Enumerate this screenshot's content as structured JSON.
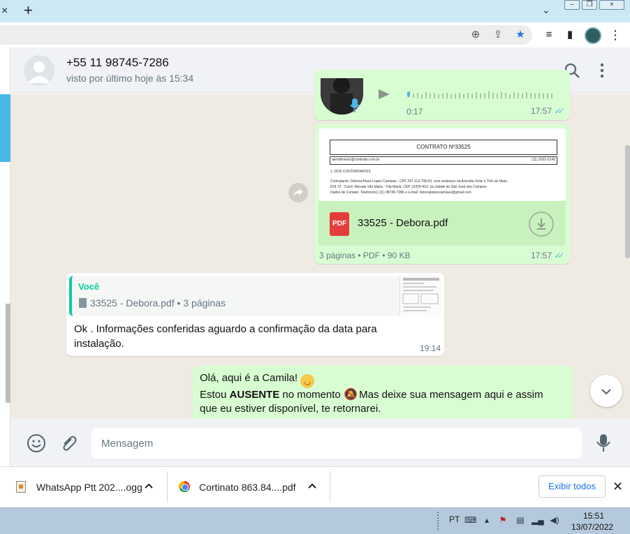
{
  "browser": {
    "tab_close": "×",
    "new_tab": "+",
    "tab_search": "⌄",
    "window_min": "–",
    "window_restore": "❐",
    "window_close": "×"
  },
  "toolbar": {
    "zoom_icon": "⊕",
    "share_icon": "⇪",
    "star_icon": "★",
    "media_icon": "≡",
    "sidepanel_icon": "▮",
    "menu_icon": "⋮"
  },
  "chat_header": {
    "contact_name": "+55 11 98745-7286",
    "status": "visto por último hoje às 15:34"
  },
  "messages": {
    "audio": {
      "duration": "0:17",
      "time": "17:57",
      "ticks": "✓✓"
    },
    "pdf": {
      "preview_title": "CONTRATO Nº33525",
      "preview_email": "atendimento@cortinato.com.br",
      "preview_phone": "(11) 2022-2148",
      "preview_section": "1. DOS CONTRATANTES",
      "preview_line1": "Contratante: Debora Alves Lopes Camisao , CPF 247.113.758-00, com endereço na Avenida Vinte e Três de Maio,",
      "preview_line2": "819 72 - Cond. Morada Vila Maria - Vila Maria, CEP 12209-410, na cidade de São José dos Campos-",
      "preview_line3": "Dados de Contato: Telefone(s) (11) 98745-7286 e e-mail: deboralopescamisao@gmail.com",
      "icon_label": "PDF",
      "file_name": "33525 - Debora.pdf",
      "meta": "3 páginas • PDF • 90 KB",
      "time": "17:57",
      "ticks": "✓✓"
    },
    "reply": {
      "quote_author": "Você",
      "quote_text": "33525 - Debora.pdf • 3 páginas",
      "text": "Ok . Informações conferidas   aguardo a confirmação da data para instalação.",
      "time": "19:14"
    },
    "auto_reply": {
      "line1_text": "Olá, aqui é a Camila! ",
      "line2_prefix": "Estou ",
      "line2_bold": "AUSENTE",
      "line2_middle": " no momento ",
      "line2_suffix": " Mas deixe sua mensagem aqui e assim",
      "line3": "que eu estiver disponível, te retornarei."
    }
  },
  "compose": {
    "placeholder": "Mensagem"
  },
  "downloads": {
    "item1_name": "WhatsApp Ptt 202....ogg",
    "item2_name": "Cortinato  863.84....pdf",
    "caret": "^",
    "show_all": "Exibir todos",
    "close": "✕"
  },
  "taskbar": {
    "lang": "PT",
    "time": "15:51",
    "date": "13/07/2022"
  }
}
